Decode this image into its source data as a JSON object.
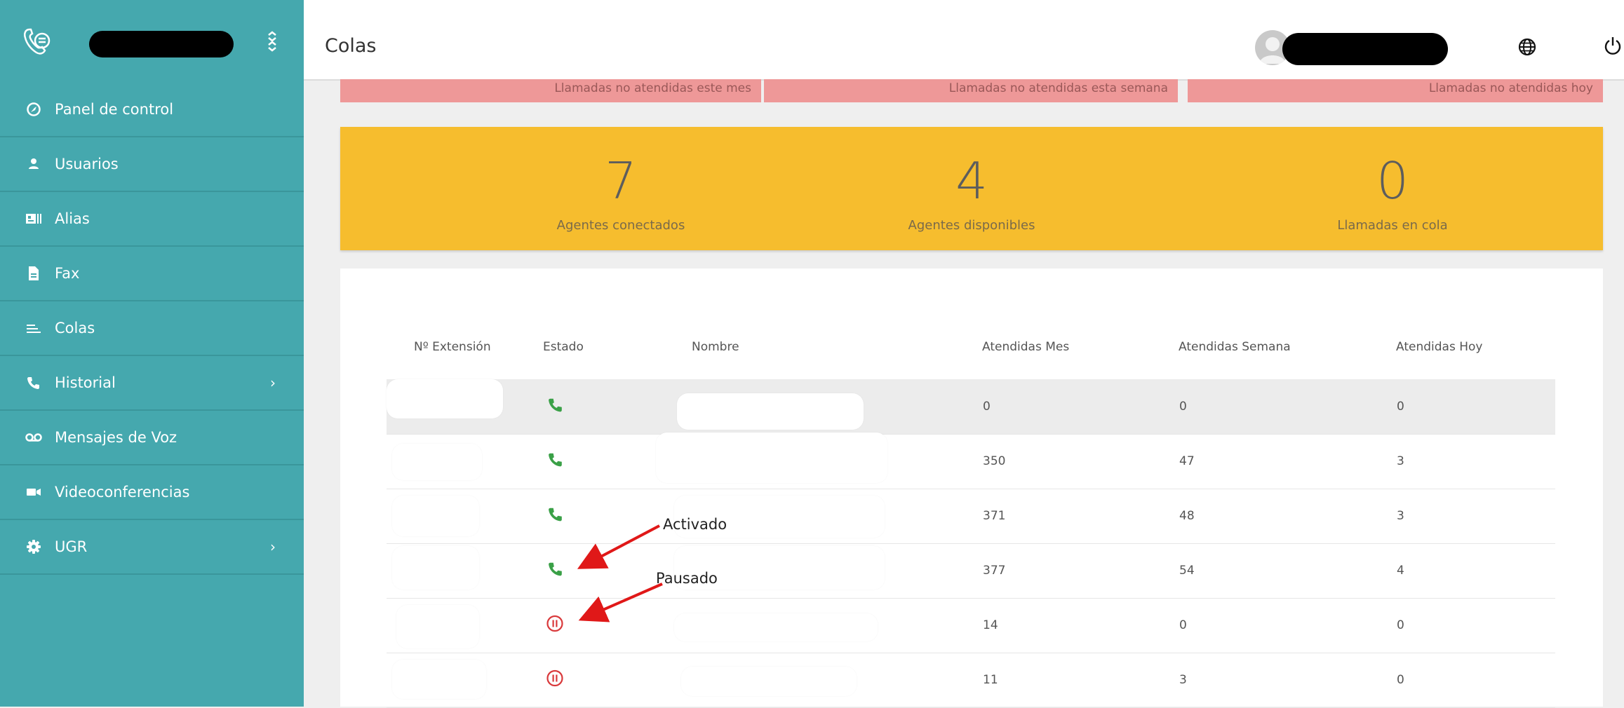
{
  "header": {
    "title": "Colas"
  },
  "sidebar": {
    "items": [
      {
        "label": "Panel de control",
        "icon": "dashboard-icon"
      },
      {
        "label": "Usuarios",
        "icon": "user-icon"
      },
      {
        "label": "Alias",
        "icon": "id-card-icon"
      },
      {
        "label": "Fax",
        "icon": "file-icon"
      },
      {
        "label": "Colas",
        "icon": "queue-icon"
      },
      {
        "label": "Historial",
        "icon": "phone-icon"
      },
      {
        "label": "Mensajes de Voz",
        "icon": "voicemail-icon"
      },
      {
        "label": "Videoconferencias",
        "icon": "video-icon"
      },
      {
        "label": "UGR",
        "icon": "gear-icon"
      }
    ]
  },
  "banners": [
    "Llamadas no atendidas este mes",
    "Llamadas no atendidas esta semana",
    "Llamadas no atendidas hoy"
  ],
  "stats": [
    {
      "value": "7",
      "caption": "Agentes conectados"
    },
    {
      "value": "4",
      "caption": "Agentes disponibles"
    },
    {
      "value": "0",
      "caption": "Llamadas en cola"
    }
  ],
  "table": {
    "headers": [
      "Nº Extensión",
      "Estado",
      "Nombre",
      "Atendidas Mes",
      "Atendidas Semana",
      "Atendidas Hoy"
    ],
    "rows": [
      {
        "estado": "activo",
        "mes": "0",
        "semana": "0",
        "hoy": "0"
      },
      {
        "estado": "activo",
        "mes": "350",
        "semana": "47",
        "hoy": "3"
      },
      {
        "estado": "activo",
        "mes": "371",
        "semana": "48",
        "hoy": "3"
      },
      {
        "estado": "activo",
        "mes": "377",
        "semana": "54",
        "hoy": "4"
      },
      {
        "estado": "pausado",
        "mes": "14",
        "semana": "0",
        "hoy": "0"
      },
      {
        "estado": "pausado",
        "mes": "11",
        "semana": "3",
        "hoy": "0"
      }
    ]
  },
  "annotations": {
    "activado": "Activado",
    "pausado": "Pausado"
  },
  "colors": {
    "sidebar": "#45a8ae",
    "banner": "#ee9898",
    "stats": "#f6bd2e",
    "active": "#3aa047",
    "paused": "#d9393b",
    "arrow": "#e01818"
  }
}
